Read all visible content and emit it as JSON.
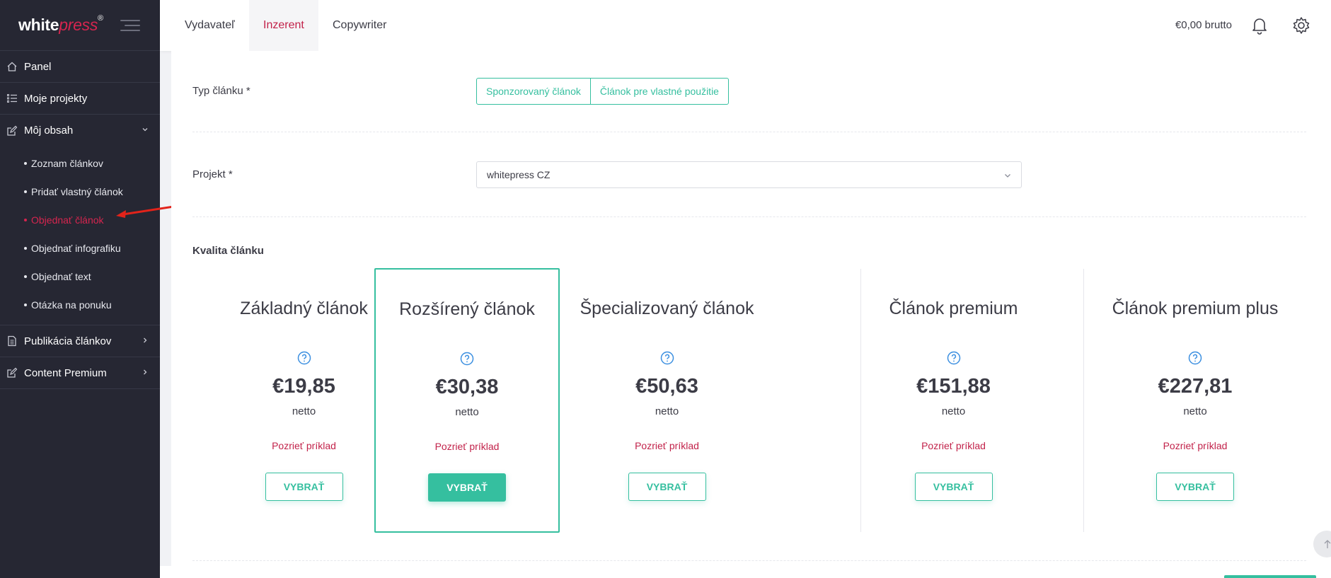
{
  "brand": {
    "logo_white": "white",
    "logo_press": "press",
    "logo_reg": "®"
  },
  "sidebar": {
    "items": [
      {
        "label": "Panel",
        "icon": "home-icon"
      },
      {
        "label": "Moje projekty",
        "icon": "list-icon"
      },
      {
        "label": "Môj obsah",
        "icon": "edit-icon",
        "expanded": true
      },
      {
        "label": "Publikácia článkov",
        "icon": "document-icon"
      },
      {
        "label": "Content Premium",
        "icon": "edit-icon"
      }
    ],
    "submenu": [
      {
        "label": "Zoznam článkov"
      },
      {
        "label": "Pridať vlastný článok"
      },
      {
        "label": "Objednať článok",
        "active": true
      },
      {
        "label": "Objednať infografiku"
      },
      {
        "label": "Objednať text"
      },
      {
        "label": "Otázka na ponuku"
      }
    ]
  },
  "topbar": {
    "tabs": [
      "Vydavateľ",
      "Inzerent",
      "Copywriter"
    ],
    "active_tab": "Inzerent",
    "balance": "€0,00 brutto"
  },
  "form": {
    "type_label": "Typ článku *",
    "type_options": [
      "Sponzorovaný článok",
      "Článok pre vlastné použitie"
    ],
    "project_label": "Projekt *",
    "project_value": "whitepress CZ",
    "quality_title": "Kvalita článku"
  },
  "cards": [
    {
      "title": "Základný článok",
      "price": "€19,85",
      "netto": "netto",
      "example": "Pozrieť príklad",
      "button": "VYBRAŤ"
    },
    {
      "title": "Rozšírený článok",
      "price": "€30,38",
      "netto": "netto",
      "example": "Pozrieť príklad",
      "button": "VYBRAŤ",
      "selected": true
    },
    {
      "title": "Špecializovaný článok",
      "price": "€50,63",
      "netto": "netto",
      "example": "Pozrieť príklad",
      "button": "VYBRAŤ"
    },
    {
      "title": "Článok premium",
      "price": "€151,88",
      "netto": "netto",
      "example": "Pozrieť príklad",
      "button": "VYBRAŤ"
    },
    {
      "title": "Článok premium plus",
      "price": "€227,81",
      "netto": "netto",
      "example": "Pozrieť príklad",
      "button": "VYBRAŤ"
    }
  ],
  "colors": {
    "accent": "#35bf9f",
    "brand_red": "#c2224a",
    "sidebar_bg": "#262733"
  }
}
